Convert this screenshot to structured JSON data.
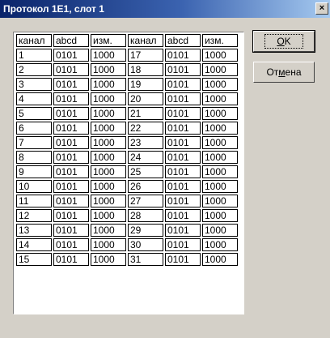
{
  "window": {
    "title": "Протокол 1E1, слот 1",
    "close_glyph": "×"
  },
  "buttons": {
    "ok_pre": "",
    "ok_mnemonic": "O",
    "ok_post": "K",
    "cancel_pre": "От",
    "cancel_mnemonic": "м",
    "cancel_post": "ена"
  },
  "table": {
    "headers": [
      "канал",
      "abcd",
      "изм.",
      "канал",
      "abcd",
      "изм."
    ],
    "rows": [
      [
        "1",
        "0101",
        "1000",
        "17",
        "0101",
        "1000"
      ],
      [
        "2",
        "0101",
        "1000",
        "18",
        "0101",
        "1000"
      ],
      [
        "3",
        "0101",
        "1000",
        "19",
        "0101",
        "1000"
      ],
      [
        "4",
        "0101",
        "1000",
        "20",
        "0101",
        "1000"
      ],
      [
        "5",
        "0101",
        "1000",
        "21",
        "0101",
        "1000"
      ],
      [
        "6",
        "0101",
        "1000",
        "22",
        "0101",
        "1000"
      ],
      [
        "7",
        "0101",
        "1000",
        "23",
        "0101",
        "1000"
      ],
      [
        "8",
        "0101",
        "1000",
        "24",
        "0101",
        "1000"
      ],
      [
        "9",
        "0101",
        "1000",
        "25",
        "0101",
        "1000"
      ],
      [
        "10",
        "0101",
        "1000",
        "26",
        "0101",
        "1000"
      ],
      [
        "11",
        "0101",
        "1000",
        "27",
        "0101",
        "1000"
      ],
      [
        "12",
        "0101",
        "1000",
        "28",
        "0101",
        "1000"
      ],
      [
        "13",
        "0101",
        "1000",
        "29",
        "0101",
        "1000"
      ],
      [
        "14",
        "0101",
        "1000",
        "30",
        "0101",
        "1000"
      ],
      [
        "15",
        "0101",
        "1000",
        "31",
        "0101",
        "1000"
      ]
    ]
  }
}
